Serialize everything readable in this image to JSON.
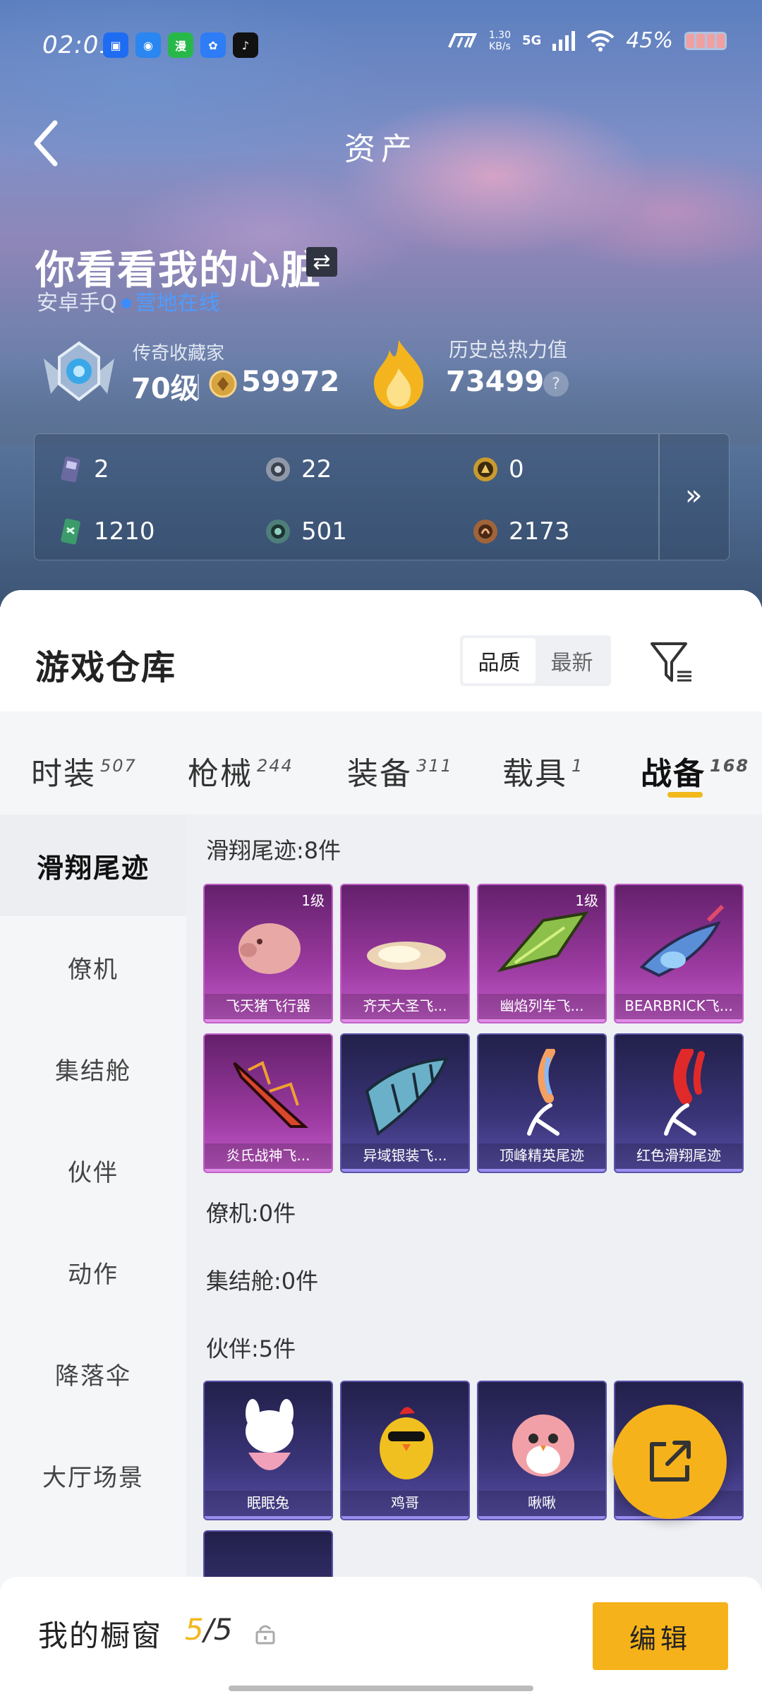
{
  "status": {
    "time": "02:01",
    "apps": [
      {
        "icon": "app-blue-icon",
        "glyph": "▣",
        "color": "#1e6cf2"
      },
      {
        "icon": "app-blue-outline-icon",
        "glyph": "◉",
        "color": "#2a86f0"
      },
      {
        "icon": "app-green-icon",
        "glyph": "漫",
        "color": "#28b84a"
      },
      {
        "icon": "baidu-icon",
        "glyph": "✿",
        "color": "#2e7cf6"
      },
      {
        "icon": "music-icon",
        "glyph": "♪",
        "color": "#111111"
      }
    ],
    "net_speed": "1.30",
    "net_unit": "KB/s",
    "signal": "5G",
    "battery": "45%"
  },
  "header": {
    "title": "资产"
  },
  "profile": {
    "name": "你看看我的心脏",
    "platform": "安卓手Q",
    "status": "营地在线",
    "rank_title": "传奇收藏家",
    "level": "70级",
    "coins": "59972",
    "heat_label": "历史总热力值",
    "heat": "73499",
    "help": "?"
  },
  "currencies": [
    {
      "icon": "card-ticket-icon",
      "value": "2",
      "color": "#6a6aa0"
    },
    {
      "icon": "silver-coin-icon",
      "value": "22",
      "color": "#8f98a8"
    },
    {
      "icon": "gold-coin-icon",
      "value": "0",
      "color": "#c99a2e"
    },
    {
      "icon": "green-ticket-icon",
      "value": "1210",
      "color": "#3c9b6a"
    },
    {
      "icon": "teal-coin-icon",
      "value": "501",
      "color": "#4e7f7a"
    },
    {
      "icon": "bronze-coin-icon",
      "value": "2173",
      "color": "#a0643a"
    }
  ],
  "more": "»",
  "warehouse": {
    "title": "游戏仓库",
    "sort": [
      "品质",
      "最新"
    ]
  },
  "tabs": [
    {
      "label": "时装",
      "count": "507"
    },
    {
      "label": "枪械",
      "count": "244"
    },
    {
      "label": "装备",
      "count": "311"
    },
    {
      "label": "载具",
      "count": "1"
    },
    {
      "label": "战备",
      "count": "168"
    }
  ],
  "side": [
    "滑翔尾迹",
    "僚机",
    "集结舱",
    "伙伴",
    "动作",
    "降落伞",
    "大厅场景"
  ],
  "sections": {
    "trails": "滑翔尾迹:8件",
    "wingman": "僚机:0件",
    "pod": "集结舱:0件",
    "partner": "伙伴:5件"
  },
  "trail_items": [
    {
      "name": "飞天猪飞行器",
      "level": "1级",
      "color": "#e8a8a6"
    },
    {
      "name": "齐天大圣飞...",
      "level": "",
      "color": "#f5e6b8"
    },
    {
      "name": "幽焰列车飞...",
      "level": "1级",
      "color": "#8cc04a"
    },
    {
      "name": "BEARBRICK飞...",
      "level": "",
      "color": "#5a8fd8"
    },
    {
      "name": "炎氏战神飞...",
      "level": "",
      "color": "#d8472a"
    },
    {
      "name": "异域银装飞...",
      "level": "",
      "color": "#6ab0c8"
    },
    {
      "name": "顶峰精英尾迹",
      "level": "",
      "color": "#f5a060"
    },
    {
      "name": "红色滑翔尾迹",
      "level": "",
      "color": "#e02a2a"
    }
  ],
  "partner_items": [
    {
      "name": "眠眠兔",
      "color": "#f0a0b8"
    },
    {
      "name": "鸡哥",
      "color": "#f0c020"
    },
    {
      "name": "啾啾",
      "color": "#f2a0a8"
    },
    {
      "name": "",
      "color": "#3a3478"
    }
  ],
  "cabinet": {
    "label": "我的橱窗",
    "current": "5",
    "total": "/5",
    "edit": "编辑"
  }
}
